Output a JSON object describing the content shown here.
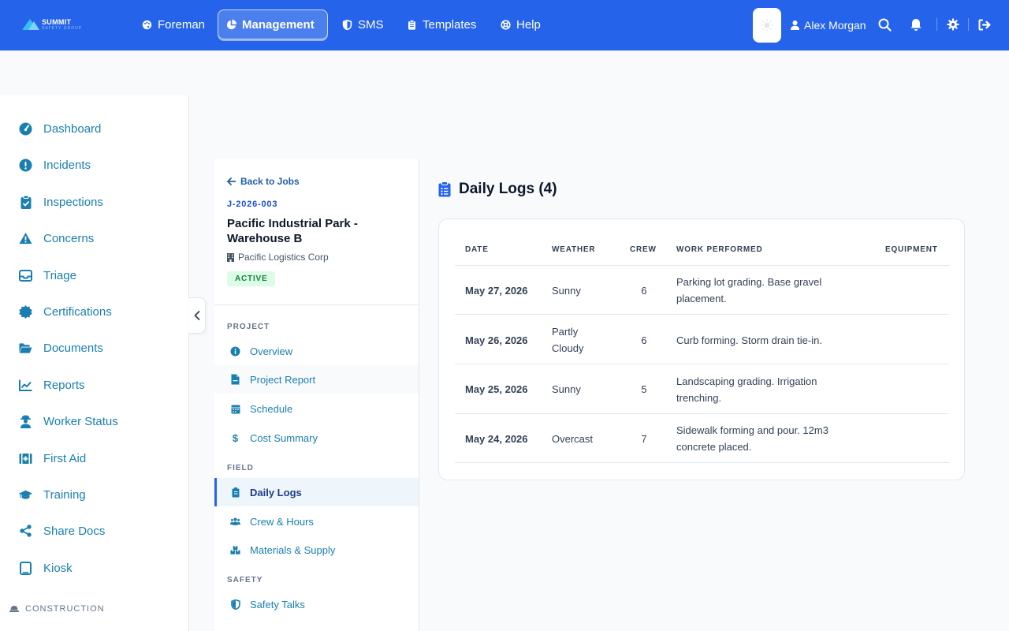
{
  "brand": {
    "name": "SUMMIT",
    "subtitle": "SAFETY GROUP"
  },
  "nav": {
    "tabs": [
      {
        "label": "Foreman",
        "icon": "palette-icon"
      },
      {
        "label": "Management",
        "icon": "pie-chart-icon",
        "active": true
      },
      {
        "label": "SMS",
        "icon": "shield-icon"
      },
      {
        "label": "Templates",
        "icon": "clipboard-icon"
      },
      {
        "label": "Help",
        "icon": "lifebuoy-icon"
      }
    ],
    "user": "Alex Morgan"
  },
  "sidebar": {
    "items": [
      {
        "label": "Dashboard",
        "icon": "gauge-icon"
      },
      {
        "label": "Incidents",
        "icon": "alert-circle-icon"
      },
      {
        "label": "Inspections",
        "icon": "clipboard-check-icon"
      },
      {
        "label": "Concerns",
        "icon": "warning-triangle-icon"
      },
      {
        "label": "Triage",
        "icon": "inbox-icon"
      },
      {
        "label": "Certifications",
        "icon": "certificate-icon"
      },
      {
        "label": "Documents",
        "icon": "folder-open-icon"
      },
      {
        "label": "Reports",
        "icon": "line-chart-icon"
      },
      {
        "label": "Worker Status",
        "icon": "worker-icon"
      },
      {
        "label": "First Aid",
        "icon": "medkit-icon"
      },
      {
        "label": "Training",
        "icon": "graduation-cap-icon"
      },
      {
        "label": "Share Docs",
        "icon": "share-icon"
      },
      {
        "label": "Kiosk",
        "icon": "tablet-icon"
      }
    ],
    "section": "CONSTRUCTION"
  },
  "job": {
    "back_label": "Back to Jobs",
    "code": "J-2026-003",
    "title": "Pacific Industrial Park - Warehouse B",
    "client": "Pacific Logistics Corp",
    "status": "ACTIVE",
    "sections": [
      {
        "title": "PROJECT",
        "items": [
          {
            "label": "Overview",
            "icon": "info-icon"
          },
          {
            "label": "Project Report",
            "icon": "pdf-file-icon"
          },
          {
            "label": "Schedule",
            "icon": "calendar-icon"
          },
          {
            "label": "Cost Summary",
            "icon": "dollar-icon"
          }
        ]
      },
      {
        "title": "FIELD",
        "items": [
          {
            "label": "Daily Logs",
            "icon": "clipboard-list-icon",
            "active": true
          },
          {
            "label": "Crew & Hours",
            "icon": "users-icon"
          },
          {
            "label": "Materials & Supply",
            "icon": "boxes-icon"
          }
        ]
      },
      {
        "title": "SAFETY",
        "items": [
          {
            "label": "Safety Talks",
            "icon": "shield-icon"
          }
        ]
      }
    ]
  },
  "daily_logs": {
    "title": "Daily Logs (4)",
    "columns": [
      "DATE",
      "WEATHER",
      "CREW",
      "WORK PERFORMED",
      "EQUIPMENT"
    ],
    "rows": [
      {
        "date": "May 27, 2026",
        "weather": "Sunny",
        "crew": "6",
        "work": "Parking lot grading. Base gravel placement.",
        "equipment": ""
      },
      {
        "date": "May 26, 2026",
        "weather": "Partly Cloudy",
        "crew": "6",
        "work": "Curb forming. Storm drain tie-in.",
        "equipment": ""
      },
      {
        "date": "May 25, 2026",
        "weather": "Sunny",
        "crew": "5",
        "work": "Landscaping grading. Irrigation trenching.",
        "equipment": ""
      },
      {
        "date": "May 24, 2026",
        "weather": "Overcast",
        "crew": "7",
        "work": "Sidewalk forming and pour. 12m3 concrete placed.",
        "equipment": ""
      }
    ]
  },
  "colors": {
    "nav_bg": "#2563eb",
    "link": "#1a7fb0",
    "active_badge_bg": "#dcfce7",
    "active_badge_fg": "#15803d"
  }
}
